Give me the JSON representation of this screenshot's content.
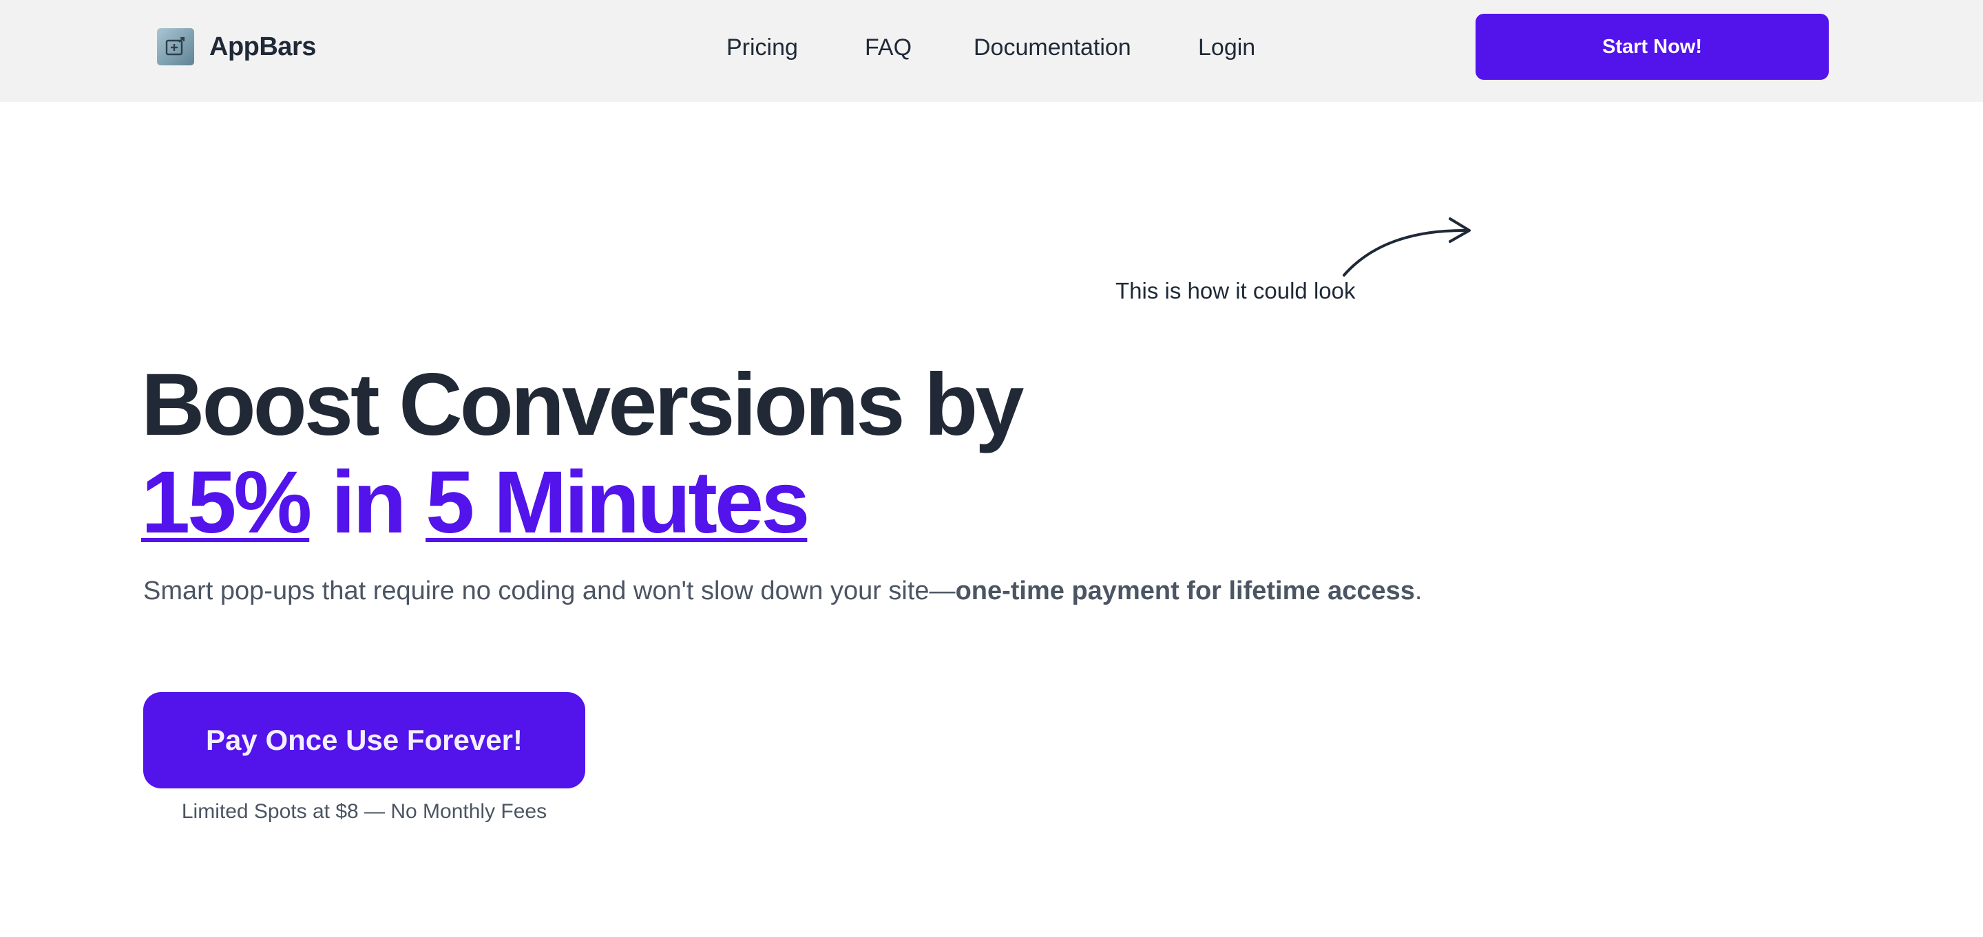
{
  "brand": {
    "name": "AppBars",
    "logo_icon": "add-to-screen-icon"
  },
  "nav": {
    "items": [
      {
        "label": "Pricing"
      },
      {
        "label": "FAQ"
      },
      {
        "label": "Documentation"
      },
      {
        "label": "Login"
      }
    ]
  },
  "header": {
    "cta_label": "Start Now!"
  },
  "annotation": {
    "text": "This is how it could look",
    "icon": "curved-arrow-icon"
  },
  "hero": {
    "headline_line1": "Boost Conversions by",
    "headline_highlight_1": "15%",
    "headline_connector": "in",
    "headline_highlight_2": "5 Minutes",
    "subtext": "Smart pop-ups that require no coding and won't slow down your site—",
    "subtext_bold": "one-time payment for lifetime access",
    "subtext_end": ".",
    "cta_label": "Pay Once Use Forever!",
    "cta_note": "Limited Spots at $8 — No Monthly Fees"
  },
  "colors": {
    "accent": "#5313eb",
    "heading": "#222936",
    "body_text": "#4b5563",
    "header_bg": "#f2f2f2"
  }
}
